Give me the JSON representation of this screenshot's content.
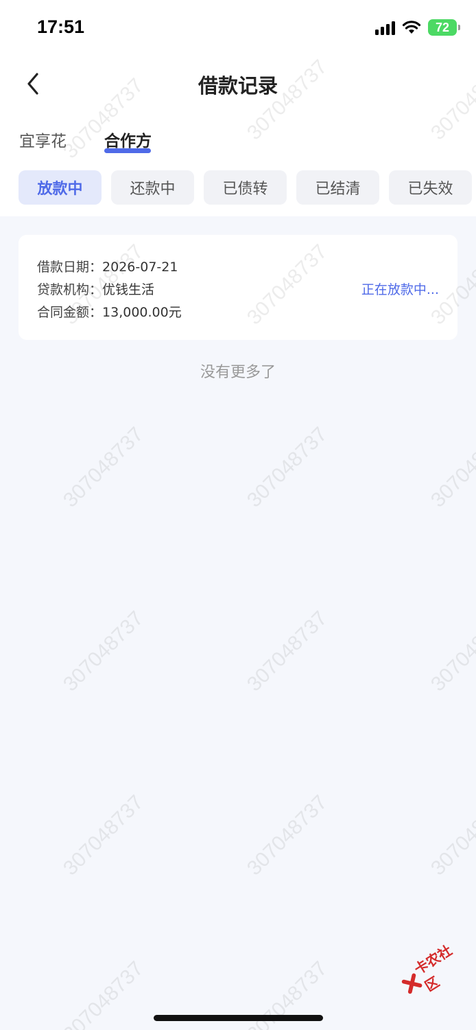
{
  "status_bar": {
    "time": "17:51",
    "battery": "72"
  },
  "nav": {
    "title": "借款记录"
  },
  "main_tabs": [
    {
      "label": "宜享花",
      "active": false
    },
    {
      "label": "合作方",
      "active": true
    }
  ],
  "filter_chips": [
    {
      "label": "放款中",
      "active": true
    },
    {
      "label": "还款中",
      "active": false
    },
    {
      "label": "已债转",
      "active": false
    },
    {
      "label": "已结清",
      "active": false
    },
    {
      "label": "已失效",
      "active": false
    }
  ],
  "loan_card": {
    "date_label": "借款日期：",
    "date_value": "2026-07-21",
    "lender_label": "贷款机构：",
    "lender_value": "优钱生活",
    "amount_label": "合同金额：",
    "amount_value": "13,000.00元",
    "status": "正在放款中..."
  },
  "list_footer": "没有更多了",
  "watermark": "307048737",
  "corner_logo": "卡农社区",
  "colors": {
    "accent": "#4f6ae8",
    "page_bg": "#f5f7fc",
    "chip_bg": "#f1f2f6"
  }
}
